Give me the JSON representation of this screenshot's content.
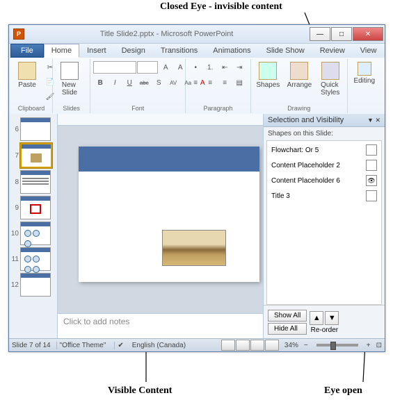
{
  "annotations": {
    "closed_eye": "Closed Eye - invisible content",
    "eye_open": "Eye open",
    "visible_content": "Visible Content"
  },
  "window": {
    "app_letter": "P",
    "title": "Title Slide2.pptx - Microsoft PowerPoint"
  },
  "menu": {
    "file": "File",
    "tabs": [
      "Home",
      "Insert",
      "Design",
      "Transitions",
      "Animations",
      "Slide Show",
      "Review",
      "View"
    ]
  },
  "ribbon": {
    "clipboard": {
      "label": "Clipboard",
      "paste": "Paste"
    },
    "slides": {
      "label": "Slides",
      "new_slide": "New\nSlide"
    },
    "font": {
      "label": "Font",
      "bold": "B",
      "italic": "I",
      "underline": "U",
      "strike": "abc",
      "shadow": "S",
      "spacing": "AV",
      "clear": "Aa"
    },
    "paragraph": {
      "label": "Paragraph"
    },
    "drawing": {
      "label": "Drawing",
      "shapes": "Shapes",
      "arrange": "Arrange",
      "quick": "Quick\nStyles"
    },
    "editing": {
      "label": "Editing",
      "editing": "Editing"
    }
  },
  "thumbnails": [
    {
      "num": "6"
    },
    {
      "num": "7"
    },
    {
      "num": "8"
    },
    {
      "num": "9"
    },
    {
      "num": "10"
    },
    {
      "num": "11"
    },
    {
      "num": "12"
    }
  ],
  "notes": {
    "placeholder": "Click to add notes"
  },
  "selection_pane": {
    "title": "Selection and Visibility",
    "subtitle": "Shapes on this Slide:",
    "items": [
      {
        "name": "Flowchart: Or 5",
        "visible": false
      },
      {
        "name": "Content Placeholder 2",
        "visible": false
      },
      {
        "name": "Content Placeholder 6",
        "visible": true
      },
      {
        "name": "Title 3",
        "visible": false
      }
    ],
    "show_all": "Show All",
    "hide_all": "Hide All",
    "reorder": "Re-order"
  },
  "status": {
    "slide": "Slide 7 of 14",
    "theme": "\"Office Theme\"",
    "lang": "English (Canada)",
    "zoom": "34%"
  }
}
